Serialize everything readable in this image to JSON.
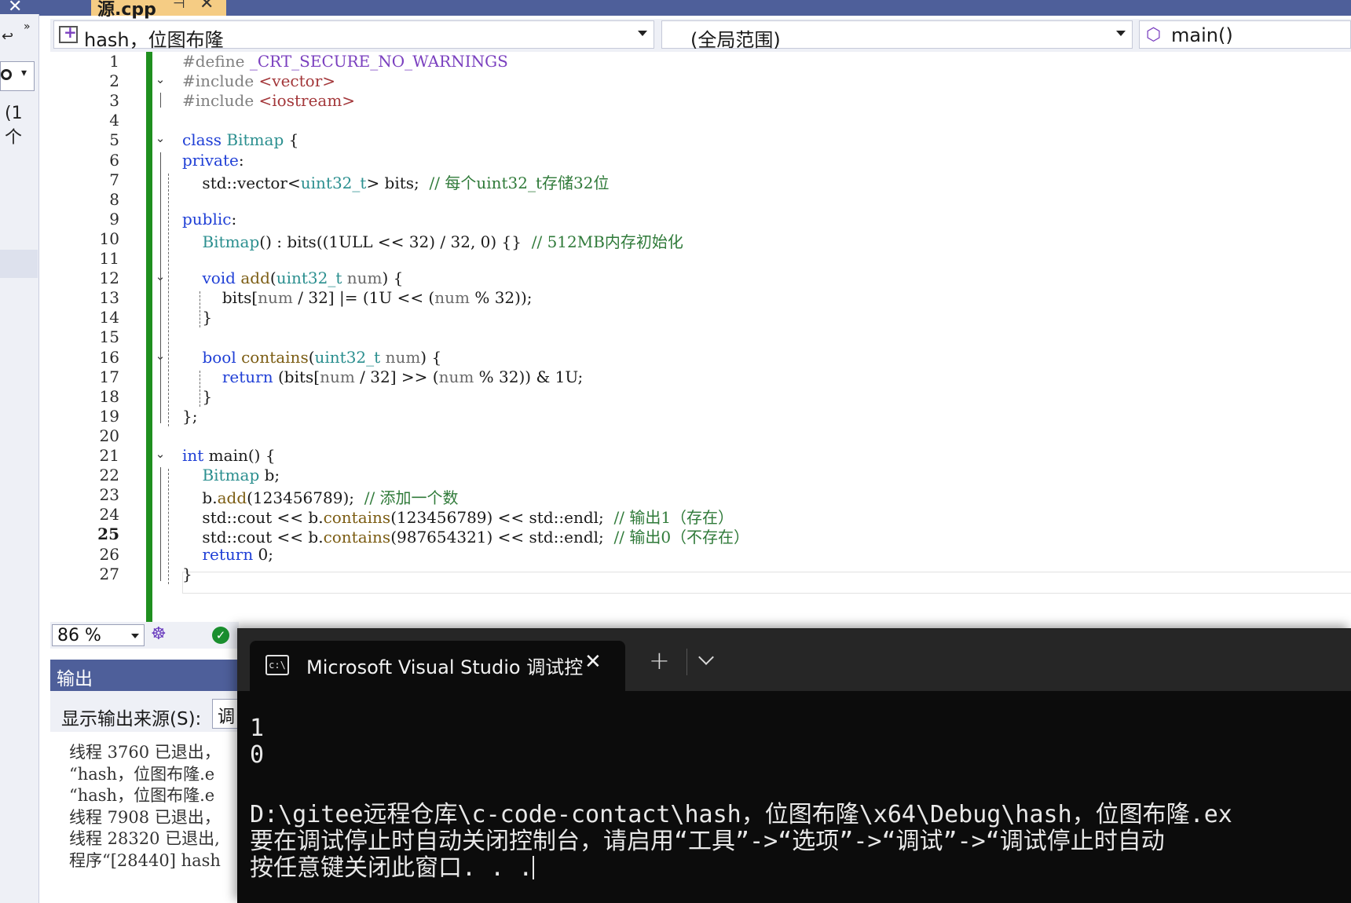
{
  "file_tab": {
    "title": "源.cpp",
    "pin_glyph": "⊣",
    "close_glyph": "✕"
  },
  "left_panel": {
    "count_text": "(1 个"
  },
  "navbar": {
    "project": "hash，位图布隆",
    "scope": "(全局范围)",
    "function": "main()"
  },
  "editor": {
    "zoom": "86 %",
    "current_line": 25,
    "line_numbers": [
      "1",
      "2",
      "3",
      "4",
      "5",
      "6",
      "7",
      "8",
      "9",
      "10",
      "11",
      "12",
      "13",
      "14",
      "15",
      "16",
      "17",
      "18",
      "19",
      "20",
      "21",
      "22",
      "23",
      "24",
      "25",
      "26",
      "27"
    ],
    "lines": [
      "#define _CRT_SECURE_NO_WARNINGS",
      "#include <vector>",
      "#include <iostream>",
      "",
      "class Bitmap {",
      "private:",
      "    std::vector<uint32_t> bits;  // 每个uint32_t存储32位",
      "",
      "public:",
      "    Bitmap() : bits((1ULL << 32) / 32, 0) {}  // 512MB内存初始化",
      "",
      "    void add(uint32_t num) {",
      "        bits[num / 32] |= (1U << (num % 32));",
      "    }",
      "",
      "    bool contains(uint32_t num) {",
      "        return (bits[num / 32] >> (num % 32)) & 1U;",
      "    }",
      "};",
      "",
      "int main() {",
      "    Bitmap b;",
      "    b.add(123456789);  // 添加一个数",
      "    std::cout << b.contains(123456789) << std::endl;  // 输出1（存在）",
      "    std::cout << b.contains(987654321) << std::endl;  // 输出0（不存在）",
      "    return 0;",
      "}"
    ]
  },
  "output": {
    "title": "输出",
    "source_label": "显示输出来源(S):",
    "source_value": "调",
    "lines": [
      "线程 3760 已退出，",
      "“hash，位图布隆.e",
      "“hash，位图布隆.e",
      "线程 7908 已退出，",
      "线程 28320 已退出,",
      "程序“[28440] hash"
    ]
  },
  "terminal": {
    "tab_title": "Microsoft Visual Studio 调试控",
    "tab_icon_text": "c:\\",
    "new_tab": "+",
    "lines": [
      "1",
      "0",
      "",
      "D:\\gitee远程仓库\\c-code-contact\\hash，位图布隆\\x64\\Debug\\hash，位图布隆.ex",
      "要在调试停止时自动关闭控制台，请启用“工具”->“选项”->“调试”->“调试停止时自动",
      "按任意键关闭此窗口. . ."
    ]
  },
  "colors": {
    "vs_chrome": "#4e5f9a",
    "tab_active": "#f5cc84",
    "change_bar": "#1f8f1f",
    "keyword": "#1f3fd6",
    "comment": "#2f7a39",
    "terminal_bg": "#0c0c0c"
  }
}
